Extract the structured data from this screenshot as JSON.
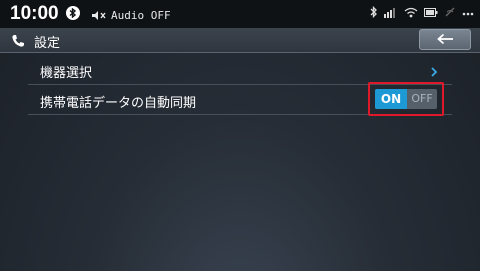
{
  "status_bar": {
    "time": "10:00",
    "audio_text": "Audio OFF",
    "icons": [
      "bluetooth-icon",
      "mute-icon",
      "bluetooth-small-icon",
      "signal-icon",
      "wifi-icon",
      "battery-icon",
      "tether-icon",
      "more-icon"
    ]
  },
  "header": {
    "title": "設定",
    "icon": "phone-icon",
    "back_icon": "back-arrow-icon"
  },
  "settings": {
    "items": [
      {
        "label": "機器選択"
      },
      {
        "label": "携帯電話データの自動同期"
      }
    ],
    "auto_sync_toggle": {
      "on_label": "ON",
      "off_label": "OFF",
      "state": "ON"
    }
  },
  "colors": {
    "accent": "#1d9ad6",
    "highlight": "#e0192a"
  }
}
